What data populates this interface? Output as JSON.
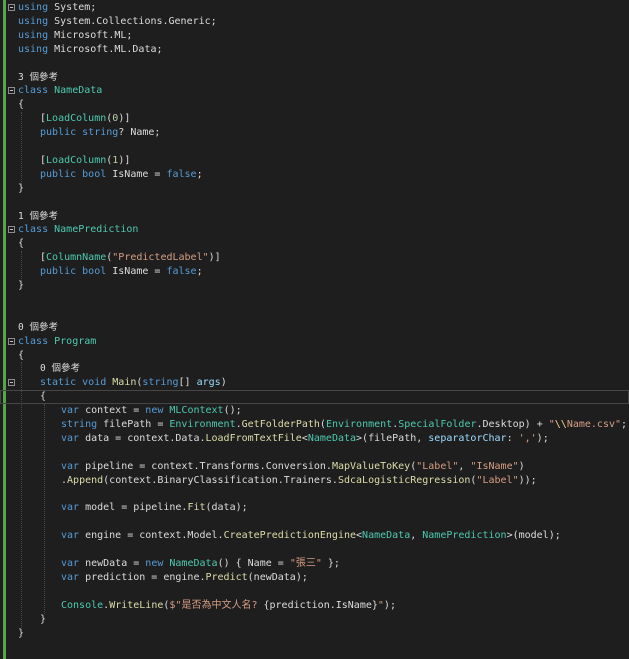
{
  "editor": {
    "lines": [
      {
        "x": 18,
        "fold": true,
        "tokens": [
          [
            "kw",
            "using"
          ],
          [
            "pl",
            " System;"
          ]
        ]
      },
      {
        "x": 18,
        "tokens": [
          [
            "kw",
            "using"
          ],
          [
            "pl",
            " System.Collections.Generic;"
          ]
        ]
      },
      {
        "x": 18,
        "tokens": [
          [
            "kw",
            "using"
          ],
          [
            "pl",
            " Microsoft.ML;"
          ]
        ]
      },
      {
        "x": 18,
        "tokens": [
          [
            "kw",
            "using"
          ],
          [
            "pl",
            " Microsoft.ML.Data;"
          ]
        ]
      },
      {
        "x": 18,
        "tokens": []
      },
      {
        "x": 18,
        "lens": true,
        "tokens": [
          [
            "pl",
            "3 個參考"
          ]
        ]
      },
      {
        "x": 18,
        "fold": true,
        "tokens": [
          [
            "kw",
            "class"
          ],
          [
            "pl",
            " "
          ],
          [
            "ty",
            "NameData"
          ]
        ]
      },
      {
        "x": 18,
        "tokens": [
          [
            "pl",
            "{"
          ]
        ]
      },
      {
        "x": 40,
        "tokens": [
          [
            "pl",
            "["
          ],
          [
            "attr",
            "LoadColumn"
          ],
          [
            "pl",
            "("
          ],
          [
            "num",
            "0"
          ],
          [
            "pl",
            ")]"
          ]
        ]
      },
      {
        "x": 40,
        "tokens": [
          [
            "kw",
            "public"
          ],
          [
            "pl",
            " "
          ],
          [
            "kw",
            "string"
          ],
          [
            "pl",
            "? Name;"
          ]
        ]
      },
      {
        "x": 40,
        "tokens": []
      },
      {
        "x": 40,
        "tokens": [
          [
            "pl",
            "["
          ],
          [
            "attr",
            "LoadColumn"
          ],
          [
            "pl",
            "("
          ],
          [
            "num",
            "1"
          ],
          [
            "pl",
            ")]"
          ]
        ]
      },
      {
        "x": 40,
        "tokens": [
          [
            "kw",
            "public"
          ],
          [
            "pl",
            " "
          ],
          [
            "kw",
            "bool"
          ],
          [
            "pl",
            " IsName = "
          ],
          [
            "kw",
            "false"
          ],
          [
            "pl",
            ";"
          ]
        ]
      },
      {
        "x": 18,
        "tokens": [
          [
            "pl",
            "}"
          ]
        ]
      },
      {
        "x": 18,
        "tokens": []
      },
      {
        "x": 18,
        "lens": true,
        "tokens": [
          [
            "pl",
            "1 個參考"
          ]
        ]
      },
      {
        "x": 18,
        "fold": true,
        "tokens": [
          [
            "kw",
            "class"
          ],
          [
            "pl",
            " "
          ],
          [
            "ty",
            "NamePrediction"
          ]
        ]
      },
      {
        "x": 18,
        "tokens": [
          [
            "pl",
            "{"
          ]
        ]
      },
      {
        "x": 40,
        "tokens": [
          [
            "pl",
            "["
          ],
          [
            "attr",
            "ColumnName"
          ],
          [
            "pl",
            "("
          ],
          [
            "str",
            "\"PredictedLabel\""
          ],
          [
            "pl",
            ")]"
          ]
        ]
      },
      {
        "x": 40,
        "tokens": [
          [
            "kw",
            "public"
          ],
          [
            "pl",
            " "
          ],
          [
            "kw",
            "bool"
          ],
          [
            "pl",
            " IsName = "
          ],
          [
            "kw",
            "false"
          ],
          [
            "pl",
            ";"
          ]
        ]
      },
      {
        "x": 18,
        "tokens": [
          [
            "pl",
            "}"
          ]
        ]
      },
      {
        "x": 18,
        "tokens": []
      },
      {
        "x": 18,
        "tokens": []
      },
      {
        "x": 18,
        "lens": true,
        "tokens": [
          [
            "pl",
            "0 個參考"
          ]
        ]
      },
      {
        "x": 18,
        "fold": true,
        "tokens": [
          [
            "kw",
            "class"
          ],
          [
            "pl",
            " "
          ],
          [
            "ty",
            "Program"
          ]
        ]
      },
      {
        "x": 18,
        "tokens": [
          [
            "pl",
            "{"
          ]
        ]
      },
      {
        "x": 40,
        "lens": true,
        "tokens": [
          [
            "pl",
            "0 個參考"
          ]
        ]
      },
      {
        "x": 40,
        "fold": true,
        "tokens": [
          [
            "kw",
            "static"
          ],
          [
            "pl",
            " "
          ],
          [
            "kw",
            "void"
          ],
          [
            "pl",
            " "
          ],
          [
            "fn",
            "Main"
          ],
          [
            "pl",
            "("
          ],
          [
            "kw",
            "string"
          ],
          [
            "pl",
            "[] "
          ],
          [
            "prm",
            "args"
          ],
          [
            "pl",
            ")"
          ]
        ]
      },
      {
        "x": 40,
        "current": true,
        "tokens": [
          [
            "pl",
            "{"
          ]
        ]
      },
      {
        "x": 61,
        "tokens": [
          [
            "kw",
            "var"
          ],
          [
            "pl",
            " context = "
          ],
          [
            "kw",
            "new"
          ],
          [
            "pl",
            " "
          ],
          [
            "ty",
            "MLContext"
          ],
          [
            "pl",
            "();"
          ]
        ]
      },
      {
        "x": 61,
        "tokens": [
          [
            "kw",
            "string"
          ],
          [
            "pl",
            " filePath = "
          ],
          [
            "ty",
            "Environment"
          ],
          [
            "pl",
            "."
          ],
          [
            "fn",
            "GetFolderPath"
          ],
          [
            "pl",
            "("
          ],
          [
            "ty",
            "Environment"
          ],
          [
            "pl",
            "."
          ],
          [
            "ty",
            "SpecialFolder"
          ],
          [
            "pl",
            ".Desktop) + "
          ],
          [
            "str",
            "\""
          ],
          [
            "esc",
            "\\\\"
          ],
          [
            "str",
            "Name.csv\""
          ],
          [
            "pl",
            ";"
          ]
        ]
      },
      {
        "x": 61,
        "tokens": [
          [
            "kw",
            "var"
          ],
          [
            "pl",
            " data = context.Data."
          ],
          [
            "fn",
            "LoadFromTextFile"
          ],
          [
            "pl",
            "<"
          ],
          [
            "ty",
            "NameData"
          ],
          [
            "pl",
            ">(filePath, "
          ],
          [
            "prm",
            "separatorChar"
          ],
          [
            "pl",
            ": "
          ],
          [
            "str",
            "','"
          ],
          [
            "pl",
            ");"
          ]
        ]
      },
      {
        "x": 61,
        "tokens": []
      },
      {
        "x": 61,
        "tokens": [
          [
            "kw",
            "var"
          ],
          [
            "pl",
            " pipeline = context.Transforms.Conversion."
          ],
          [
            "fn",
            "MapValueToKey"
          ],
          [
            "pl",
            "("
          ],
          [
            "str",
            "\"Label\""
          ],
          [
            "pl",
            ", "
          ],
          [
            "str",
            "\"IsName\""
          ],
          [
            "pl",
            ")"
          ]
        ]
      },
      {
        "x": 61,
        "tokens": [
          [
            "pl",
            "."
          ],
          [
            "fn",
            "Append"
          ],
          [
            "pl",
            "(context.BinaryClassification.Trainers."
          ],
          [
            "fn",
            "SdcaLogisticRegression"
          ],
          [
            "pl",
            "("
          ],
          [
            "str",
            "\"Label\""
          ],
          [
            "pl",
            "));"
          ]
        ]
      },
      {
        "x": 61,
        "tokens": []
      },
      {
        "x": 61,
        "tokens": [
          [
            "kw",
            "var"
          ],
          [
            "pl",
            " model = pipeline."
          ],
          [
            "fn",
            "Fit"
          ],
          [
            "pl",
            "(data);"
          ]
        ]
      },
      {
        "x": 61,
        "tokens": []
      },
      {
        "x": 61,
        "tokens": [
          [
            "kw",
            "var"
          ],
          [
            "pl",
            " engine = context.Model."
          ],
          [
            "fn",
            "CreatePredictionEngine"
          ],
          [
            "pl",
            "<"
          ],
          [
            "ty",
            "NameData"
          ],
          [
            "pl",
            ", "
          ],
          [
            "ty",
            "NamePrediction"
          ],
          [
            "pl",
            ">(model);"
          ]
        ]
      },
      {
        "x": 61,
        "tokens": []
      },
      {
        "x": 61,
        "tokens": [
          [
            "kw",
            "var"
          ],
          [
            "pl",
            " newData = "
          ],
          [
            "kw",
            "new"
          ],
          [
            "pl",
            " "
          ],
          [
            "ty",
            "NameData"
          ],
          [
            "pl",
            "() { Name = "
          ],
          [
            "str",
            "\"張三\""
          ],
          [
            "pl",
            " };"
          ]
        ]
      },
      {
        "x": 61,
        "tokens": [
          [
            "kw",
            "var"
          ],
          [
            "pl",
            " prediction = engine."
          ],
          [
            "fn",
            "Predict"
          ],
          [
            "pl",
            "(newData);"
          ]
        ]
      },
      {
        "x": 61,
        "tokens": []
      },
      {
        "x": 61,
        "tokens": [
          [
            "ty",
            "Console"
          ],
          [
            "pl",
            "."
          ],
          [
            "fn",
            "WriteLine"
          ],
          [
            "pl",
            "("
          ],
          [
            "str",
            "$\"是否為中文人名? "
          ],
          [
            "pl",
            "{prediction.IsName}"
          ],
          [
            "str",
            "\""
          ],
          [
            "pl",
            ");"
          ]
        ]
      },
      {
        "x": 40,
        "tokens": [
          [
            "pl",
            "}"
          ]
        ]
      },
      {
        "x": 18,
        "tokens": [
          [
            "pl",
            "}"
          ]
        ]
      }
    ]
  }
}
